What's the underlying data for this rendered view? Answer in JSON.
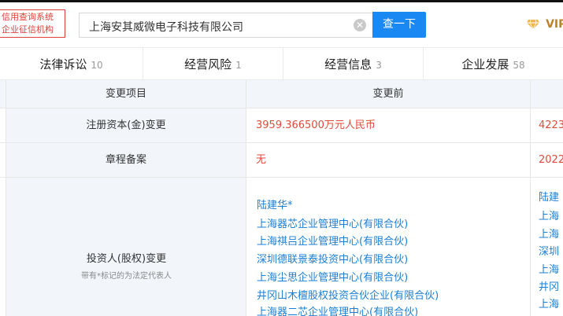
{
  "header": {
    "logo_line1": "信用查询系统",
    "logo_line2": "企业征信机构",
    "search_value": "上海安其威微电子科技有限公司",
    "search_button": "查一下",
    "vip_label": "VIP",
    "brand_red": "#e0403a",
    "accent_blue": "#1a88f3"
  },
  "tabs": [
    {
      "label": "法律诉讼",
      "count": "10"
    },
    {
      "label": "经营风险",
      "count": "1"
    },
    {
      "label": "经营信息",
      "count": "3"
    },
    {
      "label": "企业发展",
      "count": "58"
    }
  ],
  "table": {
    "col_item": "变更项目",
    "col_before": "变更前",
    "rows": [
      {
        "item": "注册资本(金)变更",
        "before": "3959.366500万元人民币",
        "after_partial": "4223"
      },
      {
        "item": "章程备案",
        "before": "无",
        "after_partial": "2022"
      }
    ],
    "investor_row": {
      "item": "投资人(股权)变更",
      "note": "带有*标记的为法定代表人",
      "before": [
        "陆建华*",
        "上海器芯企业管理中心(有限合伙)",
        "上海祺吕企业管理中心(有限合伙)",
        "深圳德联景泰投资中心(有限合伙)",
        "上海尘思企业管理中心(有限合伙)",
        "井冈山木檀股权投资合伙企业(有限合伙)",
        "上海器二芯企业管理中心(有限合伙)"
      ],
      "after_partial": [
        "陆建",
        "上海",
        "上海",
        "深圳",
        "上海",
        "井冈",
        "上海"
      ]
    }
  }
}
